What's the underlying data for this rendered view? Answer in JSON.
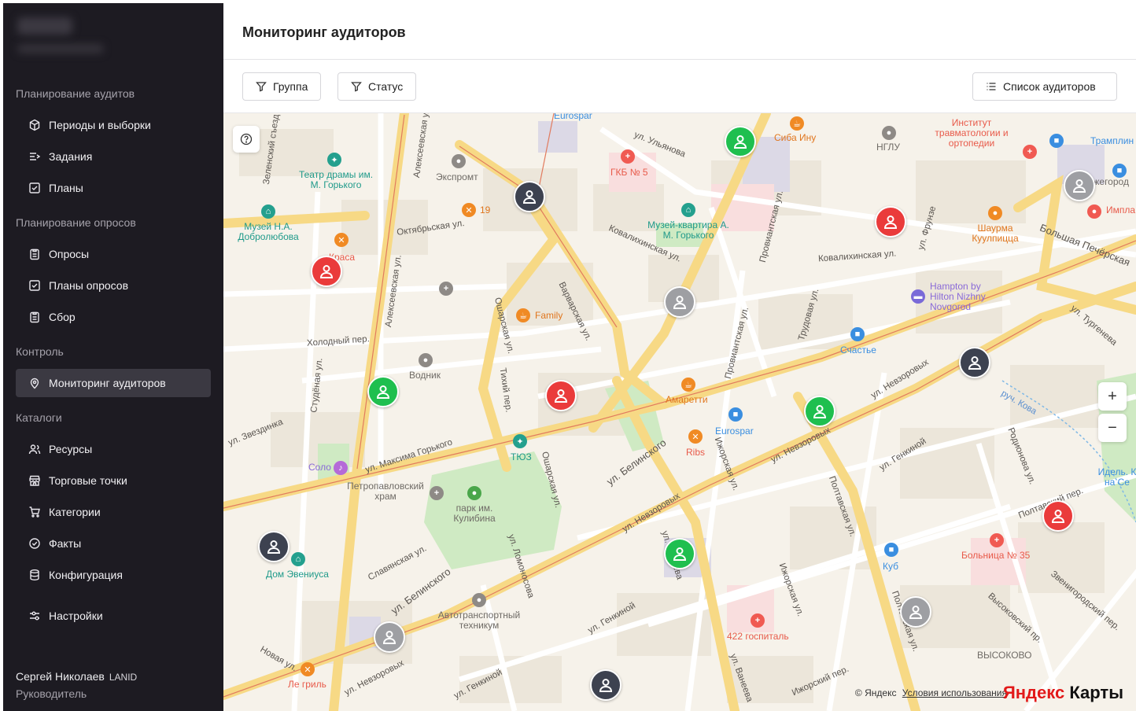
{
  "sidebar": {
    "sections": [
      {
        "title": "Планирование аудитов",
        "items": [
          "Периоды и выборки",
          "Задания",
          "Планы"
        ]
      },
      {
        "title": "Планирование опросов",
        "items": [
          "Опросы",
          "Планы опросов",
          "Сбор"
        ]
      },
      {
        "title": "Контроль",
        "items": [
          "Мониторинг аудиторов"
        ]
      },
      {
        "title": "Каталоги",
        "items": [
          "Ресурсы",
          "Торговые точки",
          "Категории",
          "Факты",
          "Конфигурация"
        ]
      }
    ],
    "settings": "Настройки",
    "user": {
      "name": "Сергей Николаев",
      "tag": "LANID",
      "role": "Руководитель"
    },
    "active_item": "Мониторинг аудиторов"
  },
  "header": {
    "title": "Мониторинг аудиторов"
  },
  "toolbar": {
    "group_filter": "Группа",
    "status_filter": "Статус",
    "auditor_list": "Список аудиторов"
  },
  "map": {
    "zoom_in": "+",
    "zoom_out": "−",
    "copyright": "© Яндекс",
    "terms": "Условия использования",
    "provider_logo_left": "Яндекс",
    "provider_logo_right": "Карты",
    "places": {
      "p01": "Eurospar",
      "p02": "Институт травматологии и ортопедии",
      "p03": "Сиба Ину",
      "p04": "НГЛУ",
      "p05": "ГКБ № 5",
      "p06": "Театр драмы им. М. Горького",
      "p07": "Экспромт",
      "p08": "19",
      "p09": "Музей-квартира А. М. Горького",
      "p10": "Музей Н.А. Добролюбова",
      "p11": "Краса",
      "p12": "Шаурма Куулпицца",
      "p13": "Hampton by Hilton Nizhny Novgorod",
      "p14": "Family",
      "p15": "Счастье",
      "p16": "Водник",
      "p17": "Амаретти",
      "p18": "Eurospar",
      "p19": "Ribs",
      "p20": "ТЮЗ",
      "p21": "Соло",
      "p22": "Петропавловский храм",
      "p23": "парк им. Кулибина",
      "p24": "Дом Эвениуса",
      "p25": "Автотранспортный техникум",
      "p26": "422 госпиталь",
      "p27": "Куб",
      "p28": "Больница № 35",
      "p29": "Ле гриль",
      "p30": "Трамплин",
      "p31": "Нижегород",
      "p32": "Импла",
      "p33": "Идель. К на Се",
      "p34": "ВЫСОКОВО"
    },
    "streets": {
      "s01": "ул. Ульянова",
      "s02": "Октябрьская ул.",
      "s03": "Ковалихинская ул.",
      "s04": "Ковалихинская ул.",
      "s05": "Большая Печёрская",
      "s06": "ул. Максима Горького",
      "s07": "ул. Белинского",
      "s08": "ул. Белинского",
      "s09": "Ошарская ул.",
      "s10": "Ошарская ул.",
      "s11": "Варварская ул.",
      "s12": "ул. Невзоровых",
      "s13": "ул. Невзоровых",
      "s14": "ул. Невзоровых",
      "s15": "ул. Генкиной",
      "s16": "ул. Генкиной",
      "s17": "Полтавская ул.",
      "s18": "Полтавская ул.",
      "s19": "Полтавский пер.",
      "s20": "Холодный пер.",
      "s21": "ул. Звездинка",
      "s22": "Алексеевская ул.",
      "s23": "Алексеевская ул.",
      "s24": "Провиантская ул.",
      "s25": "Провиантская ул.",
      "s26": "Ижорская ул.",
      "s27": "Ижорская ул.",
      "s28": "Трудовая ул.",
      "s29": "ул. Фрунзе",
      "s30": "ул. Тургенева",
      "s31": "Родионова ул.",
      "s32": "Славянская ул.",
      "s33": "ул. Ломоносова",
      "s34": "Высоковский пр.",
      "s35": "Звенигородский пер.",
      "s36": "Новая ул.",
      "s37": "ул. Ванеева",
      "s38": "Тихий пер.",
      "s39": "Студёная ул.",
      "s40": "Зеленский съезд",
      "s41": "ул. Невзоровых",
      "s42": "Ижорский пер.",
      "s43": "ул. Генкиной",
      "s44": "ул. Ванеева",
      "s45": "руч. Кова"
    }
  }
}
